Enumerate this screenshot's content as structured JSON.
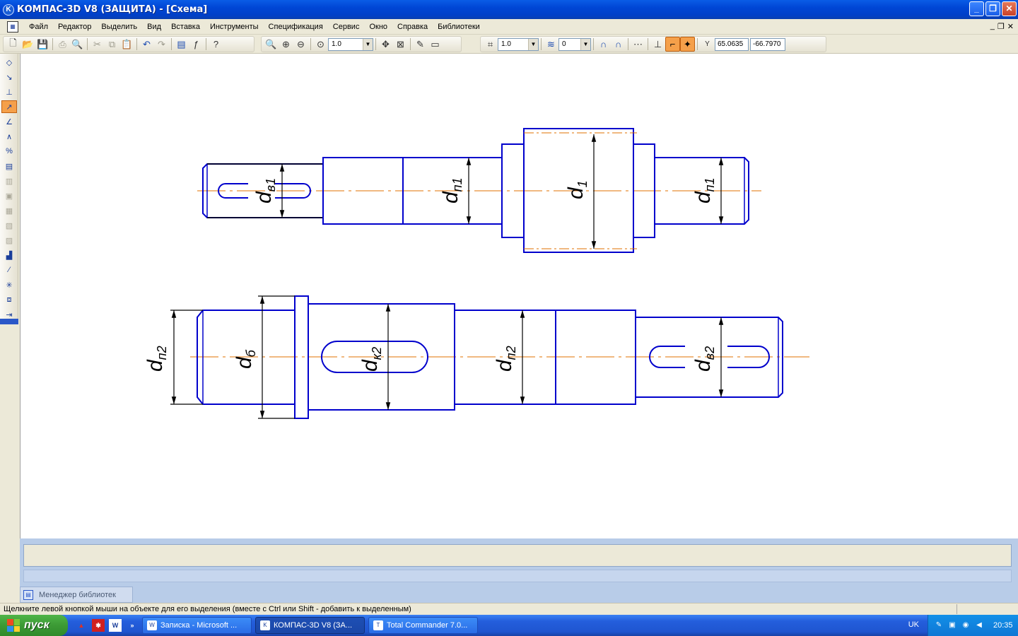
{
  "window": {
    "title": "КОМПАС-3D V8 (ЗАЩИТА) - [Схема]",
    "btn_min": "_",
    "btn_max": "❐",
    "btn_close": "✕"
  },
  "menu": {
    "items": [
      "Файл",
      "Редактор",
      "Выделить",
      "Вид",
      "Вставка",
      "Инструменты",
      "Спецификация",
      "Сервис",
      "Окно",
      "Справка",
      "Библиотеки"
    ],
    "mdi_min": "_",
    "mdi_restore": "❐",
    "mdi_close": "✕"
  },
  "toolbar": {
    "zoom_value": "1.0",
    "step_value": "1.0",
    "layer_value": "0",
    "coord_label": "Y",
    "coord_x": "65.0635",
    "coord_y": "-66.7970"
  },
  "drawing": {
    "shaft1_labels": {
      "d_v1": "d",
      "d_v1_sub": "в1",
      "d_p1a": "d",
      "d_p1a_sub": "п1",
      "d_1": "d",
      "d_1_sub": "1",
      "d_p1b": "d",
      "d_p1b_sub": "п1"
    },
    "shaft2_labels": {
      "d_p2a": "d",
      "d_p2a_sub": "п2",
      "d_b": "d",
      "d_b_sub": "б",
      "d_k2": "d",
      "d_k2_sub": "к2",
      "d_p2b": "d",
      "d_p2b_sub": "п2",
      "d_v2": "d",
      "d_v2_sub": "в2"
    },
    "colors": {
      "contour": "#0000cc",
      "axis": "#e07000",
      "dimension": "#000000"
    }
  },
  "library_manager": {
    "label": "Менеджер библиотек"
  },
  "status": {
    "hint": "Щелкните левой кнопкой мыши на объекте для его выделения (вместе с Ctrl или Shift - добавить к выделенным)"
  },
  "taskbar": {
    "start_label": "пуск",
    "quicklaunch_overflow": "»",
    "tasks": [
      {
        "label": "Записка - Microsoft ...",
        "icon": "W"
      },
      {
        "label": "КОМПАС-3D V8 (ЗА...",
        "icon": "K"
      },
      {
        "label": "Total Commander 7.0...",
        "icon": "T"
      }
    ],
    "language": "UK",
    "clock": "20:35"
  }
}
